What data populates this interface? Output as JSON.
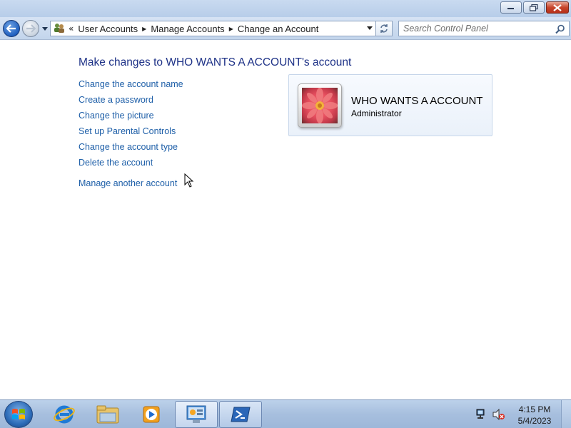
{
  "window": {
    "minimize_label": "Minimize",
    "maximize_label": "Restore",
    "close_label": "Close"
  },
  "navbar": {
    "overflow_chevron": "«",
    "breadcrumbs": [
      "User Accounts",
      "Manage Accounts",
      "Change an Account"
    ],
    "search_placeholder": "Search Control Panel"
  },
  "main": {
    "title": "Make changes to WHO WANTS A ACCOUNT's account",
    "tasks": [
      "Change the account name",
      "Create a password",
      "Change the picture",
      "Set up Parental Controls",
      "Change the account type",
      "Delete the account"
    ],
    "manage_another": "Manage another account",
    "account": {
      "name": "WHO WANTS A ACCOUNT",
      "role": "Administrator",
      "picture": "pink-flower"
    }
  },
  "taskbar": {
    "pinned": [
      "internet-explorer-icon",
      "windows-explorer-icon",
      "media-player-icon",
      "control-panel-icon",
      "powershell-icon"
    ],
    "clock_time": "4:15 PM",
    "clock_date": "5/4/2023"
  },
  "colors": {
    "link": "#1e5fa8",
    "title": "#1e3287",
    "taskbar": "#a7bfde"
  }
}
